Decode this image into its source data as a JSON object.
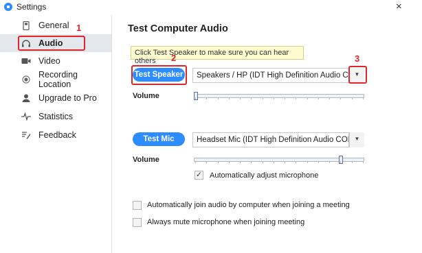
{
  "window": {
    "title": "Settings",
    "close_symbol": "×"
  },
  "sidebar": {
    "items": [
      {
        "label": "General",
        "icon": "phone-icon"
      },
      {
        "label": "Audio",
        "icon": "headphones-icon",
        "active": true
      },
      {
        "label": "Video",
        "icon": "video-camera-icon"
      },
      {
        "label": "Recording Location",
        "icon": "record-icon"
      },
      {
        "label": "Upgrade to Pro",
        "icon": "person-icon"
      },
      {
        "label": "Statistics",
        "icon": "pulse-icon"
      },
      {
        "label": "Feedback",
        "icon": "feedback-icon"
      }
    ]
  },
  "main": {
    "heading": "Test Computer Audio",
    "tooltip": "Click Test Speaker to make sure you can hear others",
    "speaker": {
      "button_label": "Test Speaker",
      "device": "Speakers / HP (IDT High Definition Audio CODEC)",
      "volume_label": "Volume",
      "volume_level": 0.0
    },
    "mic": {
      "button_label": "Test Mic",
      "device": "Headset Mic (IDT High Definition Audio CODEC)",
      "volume_label": "Volume",
      "volume_level": 0.87,
      "auto_adjust_label": "Automatically adjust microphone",
      "auto_adjust_checked": true
    },
    "options": [
      {
        "label": "Automatically join audio by computer when joining a meeting",
        "checked": false
      },
      {
        "label": "Always mute microphone when joining meeting",
        "checked": false
      }
    ]
  },
  "annotations": {
    "one": "1",
    "two": "2",
    "three": "3"
  },
  "colors": {
    "accent": "#2d8cff",
    "annotation": "#e0242b",
    "active_bg": "#e4e7ec",
    "tooltip_bg": "#fffbd0"
  }
}
